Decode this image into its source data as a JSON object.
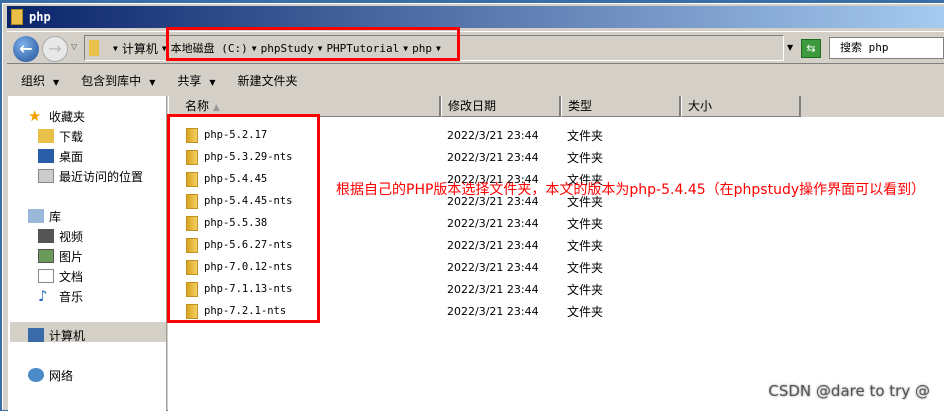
{
  "window": {
    "title": "php"
  },
  "address": {
    "crumbs": [
      "计算机",
      "本地磁盘 (C:)",
      "phpStudy",
      "PHPTutorial",
      "php"
    ],
    "search_placeholder": "搜索 php"
  },
  "toolbar": {
    "organize": "组织",
    "include": "包含到库中",
    "share": "共享",
    "new_folder": "新建文件夹"
  },
  "sidebar": {
    "favorites": "收藏夹",
    "download": "下载",
    "desktop": "桌面",
    "recent": "最近访问的位置",
    "libraries": "库",
    "videos": "视频",
    "pictures": "图片",
    "documents": "文档",
    "music": "音乐",
    "computer": "计算机",
    "network": "网络"
  },
  "columns": {
    "name": "名称",
    "date": "修改日期",
    "type": "类型",
    "size": "大小"
  },
  "files": [
    {
      "name": "php-5.2.17",
      "date": "2022/3/21 23:44",
      "type": "文件夹"
    },
    {
      "name": "php-5.3.29-nts",
      "date": "2022/3/21 23:44",
      "type": "文件夹"
    },
    {
      "name": "php-5.4.45",
      "date": "2022/3/21 23:44",
      "type": "文件夹"
    },
    {
      "name": "php-5.4.45-nts",
      "date": "2022/3/21 23:44",
      "type": "文件夹"
    },
    {
      "name": "php-5.5.38",
      "date": "2022/3/21 23:44",
      "type": "文件夹"
    },
    {
      "name": "php-5.6.27-nts",
      "date": "2022/3/21 23:44",
      "type": "文件夹"
    },
    {
      "name": "php-7.0.12-nts",
      "date": "2022/3/21 23:44",
      "type": "文件夹"
    },
    {
      "name": "php-7.1.13-nts",
      "date": "2022/3/21 23:44",
      "type": "文件夹"
    },
    {
      "name": "php-7.2.1-nts",
      "date": "2022/3/21 23:44",
      "type": "文件夹"
    }
  ],
  "annotation": "根据自己的PHP版本选择文件夹，本文的版本为php-5.4.45（在phpstudy操作界面可以看到）",
  "watermark": "CSDN @dare to try @"
}
